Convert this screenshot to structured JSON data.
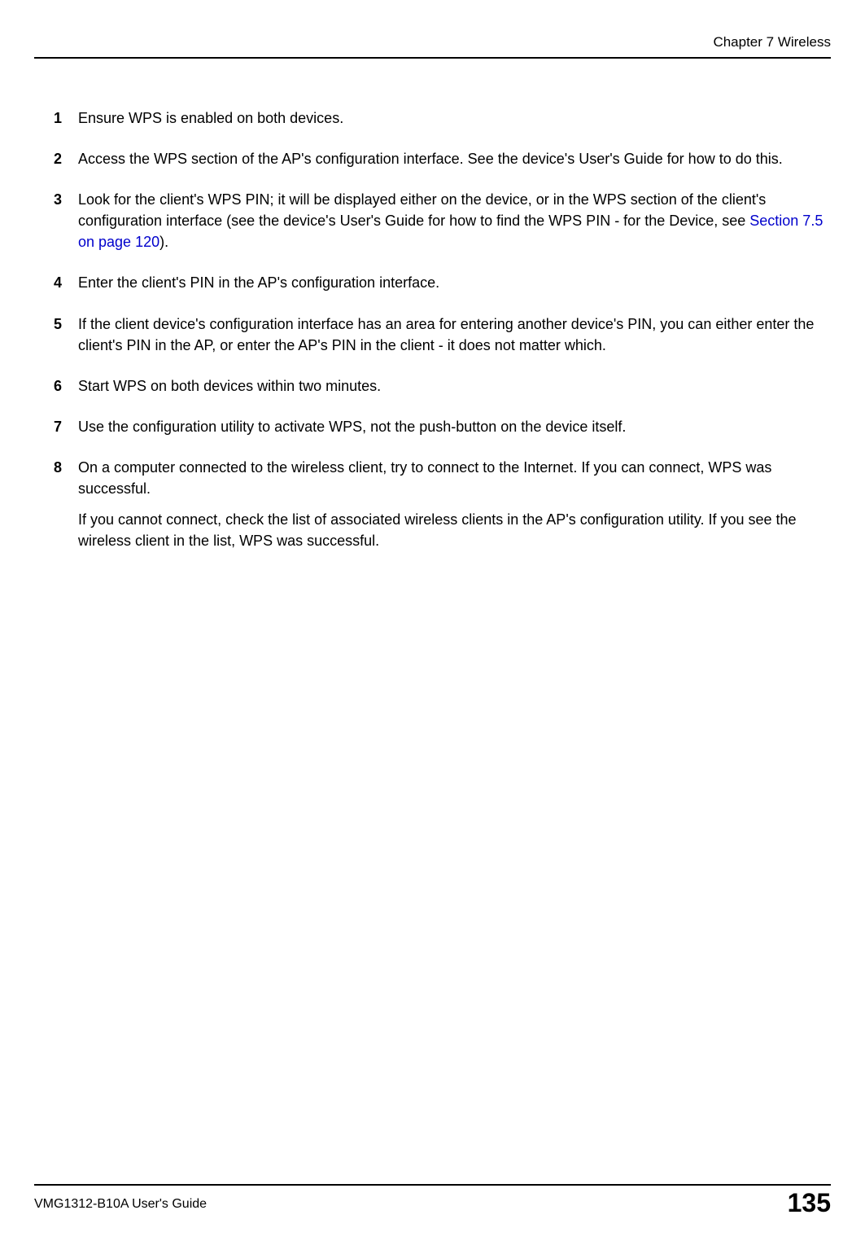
{
  "header": {
    "chapter": "Chapter 7 Wireless"
  },
  "steps": [
    {
      "num": "1",
      "paras": [
        {
          "runs": [
            {
              "text": "Ensure WPS is enabled on both devices."
            }
          ]
        }
      ]
    },
    {
      "num": "2",
      "paras": [
        {
          "runs": [
            {
              "text": "Access the WPS section of the AP's configuration interface. See the device's User's Guide for how to do this."
            }
          ]
        }
      ]
    },
    {
      "num": "3",
      "paras": [
        {
          "runs": [
            {
              "text": "Look for the client's WPS PIN; it will be displayed either on the device, or in the WPS section of the client's configuration interface (see the device's User's Guide for how to find the WPS PIN - for the Device, see "
            },
            {
              "text": "Section 7.5 on page 120",
              "xref": true
            },
            {
              "text": ")."
            }
          ]
        }
      ]
    },
    {
      "num": "4",
      "paras": [
        {
          "runs": [
            {
              "text": "Enter the client's PIN in the AP's configuration interface."
            }
          ]
        }
      ]
    },
    {
      "num": "5",
      "paras": [
        {
          "runs": [
            {
              "text": "If the client device's configuration interface has an area for entering another device's PIN, you can either enter the client's PIN in the AP, or enter the AP's PIN in the client - it does not matter which."
            }
          ]
        }
      ]
    },
    {
      "num": "6",
      "paras": [
        {
          "runs": [
            {
              "text": "Start WPS on both devices within two minutes."
            }
          ]
        }
      ]
    },
    {
      "num": "7",
      "paras": [
        {
          "runs": [
            {
              "text": "Use the configuration utility to activate WPS, not the push-button on the device itself."
            }
          ]
        }
      ]
    },
    {
      "num": "8",
      "paras": [
        {
          "runs": [
            {
              "text": "On a computer connected to the wireless client, try to connect to the Internet. If you can connect, WPS was successful."
            }
          ]
        },
        {
          "runs": [
            {
              "text": "If you cannot connect, check the list of associated wireless clients in the AP's configuration utility. If you see the wireless client in the list, WPS was successful."
            }
          ]
        }
      ]
    }
  ],
  "footer": {
    "guide": "VMG1312-B10A User's Guide",
    "page": "135"
  }
}
